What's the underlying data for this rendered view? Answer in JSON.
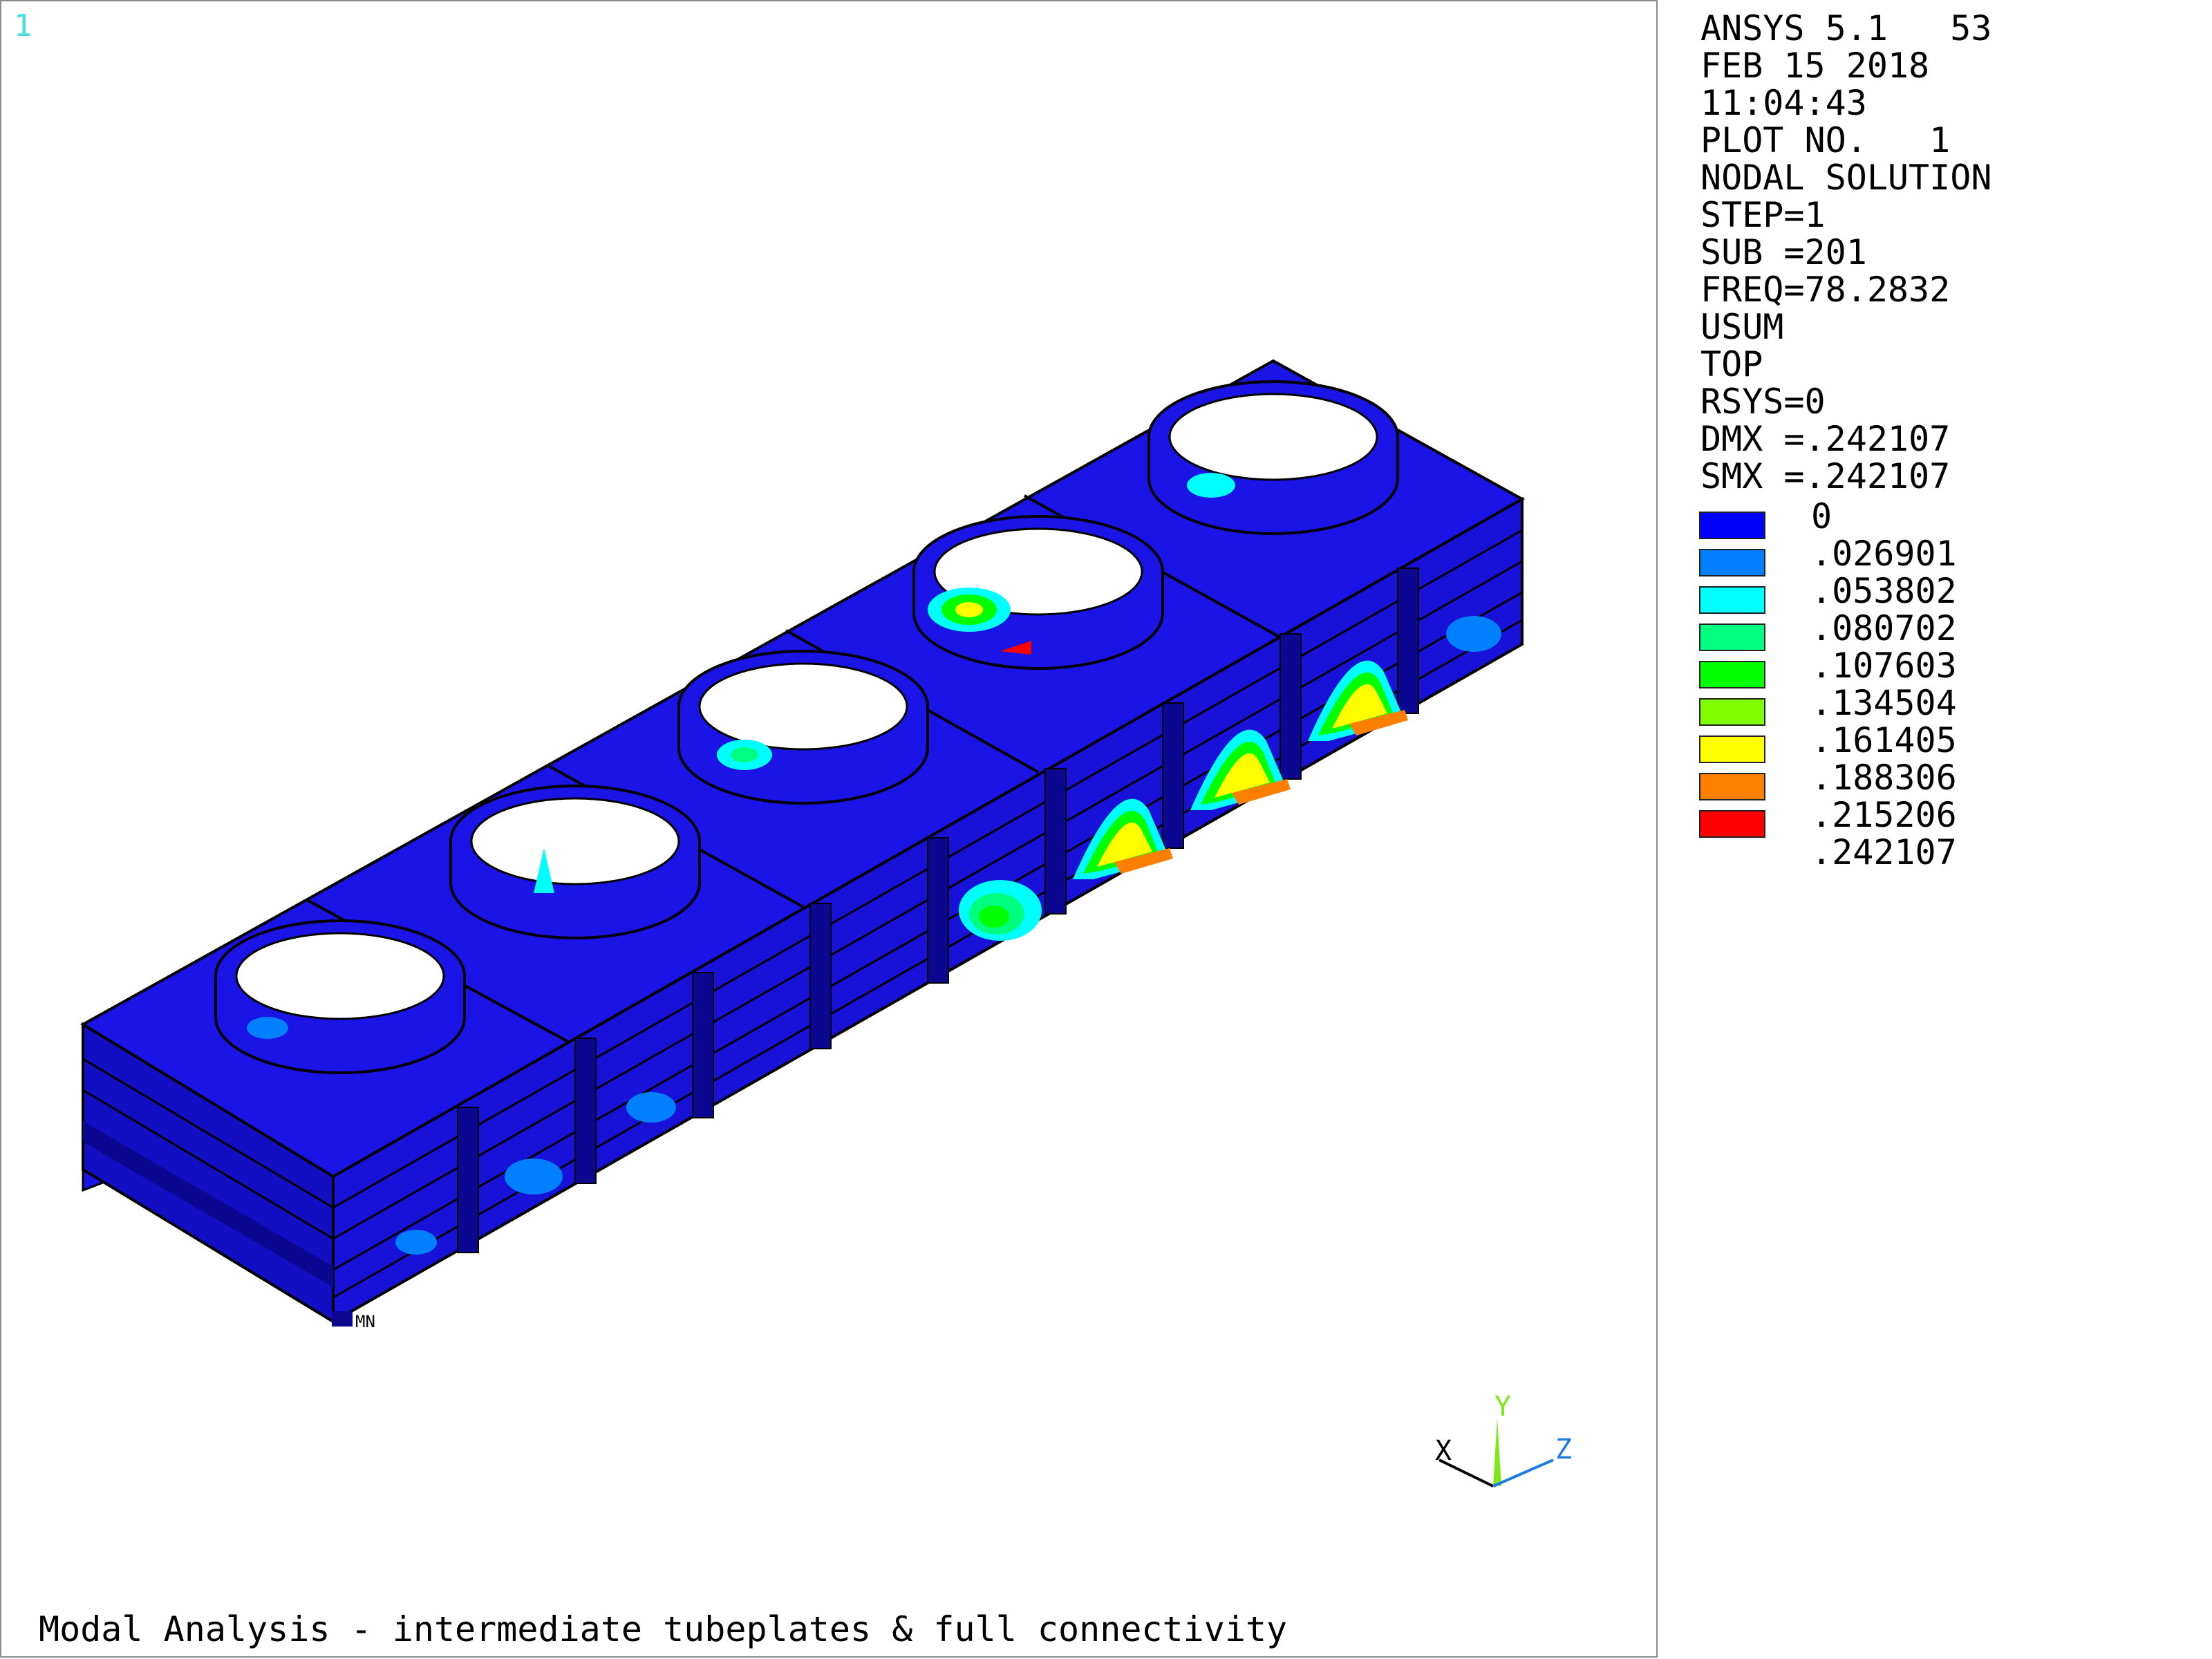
{
  "window_number": "1",
  "caption": "Modal Analysis - intermediate tubeplates & full connectivity",
  "info": {
    "lines": [
      "ANSYS 5.1   53",
      "FEB 15 2018",
      "11:04:43",
      "PLOT NO.   1",
      "NODAL SOLUTION",
      "STEP=1",
      "SUB =201",
      "FREQ=78.2832",
      "USUM",
      "TOP",
      "RSYS=0",
      "DMX =.242107",
      "SMX =.242107"
    ]
  },
  "legend": {
    "min_label": "0",
    "bands": [
      {
        "value": ".026901",
        "color": "#0000ff"
      },
      {
        "value": ".053802",
        "color": "#0080ff"
      },
      {
        "value": ".080702",
        "color": "#00ffff"
      },
      {
        "value": ".107603",
        "color": "#00ff80"
      },
      {
        "value": ".134504",
        "color": "#00ff00"
      },
      {
        "value": ".161405",
        "color": "#80ff00"
      },
      {
        "value": ".188306",
        "color": "#ffff00"
      },
      {
        "value": ".215206",
        "color": "#ff8000"
      },
      {
        "value": ".242107",
        "color": "#ff0000"
      }
    ]
  },
  "triad": {
    "x_label": "X",
    "y_label": "Y",
    "z_label": "Z"
  },
  "node_marker_label": "MN",
  "colors": {
    "structure_blue": "#1a14e6",
    "structure_dark": "#0a0890",
    "outline": "#000000",
    "axis_x": "#000000",
    "axis_y": "#7ee81a",
    "axis_z": "#1e7be6"
  }
}
